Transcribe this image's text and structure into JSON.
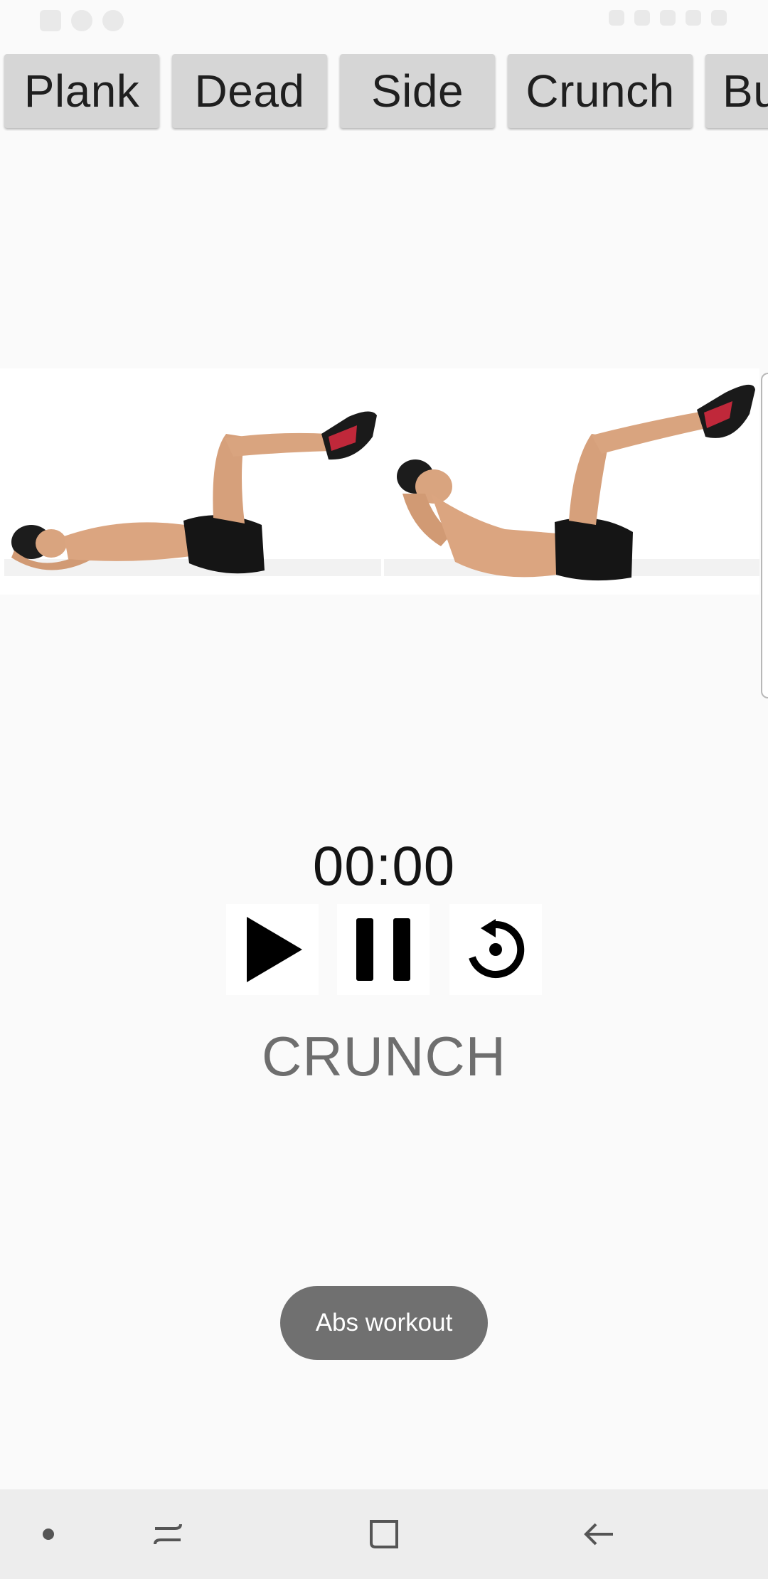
{
  "status_bar": {
    "left_icons": [
      "gallery-icon",
      "sync-icon",
      "cloud-icon"
    ],
    "right_icons": [
      "mute-icon",
      "sim-icon",
      "signal-icon",
      "wifi-icon",
      "battery-icon"
    ]
  },
  "tabs": [
    {
      "label": "Plank"
    },
    {
      "label": "Dead"
    },
    {
      "label": "Side"
    },
    {
      "label": "Crunch"
    },
    {
      "label": "Bu"
    }
  ],
  "illustration": {
    "icon": "crunch-illustration"
  },
  "timer": {
    "value": "00:00"
  },
  "controls": {
    "play_icon": "play-icon",
    "pause_icon": "pause-icon",
    "reset_icon": "reset-icon"
  },
  "exercise": {
    "name": "CRUNCH"
  },
  "toast": {
    "text": "Abs workout"
  },
  "nav_bar": {
    "icons": [
      "dot-icon",
      "recent-apps-icon",
      "home-icon",
      "back-icon"
    ]
  },
  "colors": {
    "background": "#fafafa",
    "tab_background": "#d6d6d6",
    "tab_text": "#1f1f1f",
    "timer_text": "#141414",
    "exercise_text": "#6e6e6e",
    "toast_background": "#707070",
    "nav_bar_background": "#ededed"
  }
}
